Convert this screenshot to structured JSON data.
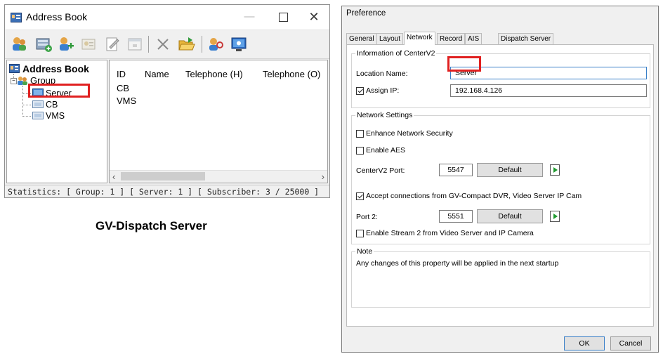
{
  "address_book": {
    "window_title": "Address Book",
    "tree": {
      "root": "Address Book",
      "group": "Group",
      "items": [
        "Server",
        "CB",
        "VMS"
      ]
    },
    "columns": [
      "ID",
      "Name",
      "Telephone (H)",
      "Telephone (O)"
    ],
    "rows": [
      "CB",
      "VMS"
    ],
    "status": "Statistics: [ Group: 1 ]  [ Server: 1 ]  [ Subscriber: 3 / 25000 ]",
    "toolbar_icons": [
      "add-group-icon",
      "add-server-icon",
      "add-subscriber-icon",
      "subscriber-card-icon",
      "edit-icon",
      "properties-icon",
      "delete-icon",
      "open-folder-icon",
      "search-icon",
      "monitor-icon"
    ]
  },
  "caption": "GV-Dispatch Server",
  "preference": {
    "title": "Preference",
    "tabs": [
      "General",
      "Layout",
      "Network",
      "Record",
      "AIS",
      "Dispatch Server"
    ],
    "active_tab": "Network",
    "info_group": {
      "label": "Information of CenterV2",
      "location_label": "Location Name:",
      "location_value": "Server",
      "assign_ip_label": "Assign IP:",
      "assign_ip_checked": true,
      "ip_value": "192.168.4.126"
    },
    "network_group": {
      "label": "Network Settings",
      "enhance_security": "Enhance Network Security",
      "enable_aes": "Enable AES",
      "port_label": "CenterV2 Port:",
      "port_value": "5547",
      "default_label": "Default",
      "accept_connections": "Accept connections from GV-Compact DVR, Video Server  IP Cam",
      "port2_label": "Port 2:",
      "port2_value": "5551",
      "default2_label": "Default",
      "enable_stream2": "Enable Stream 2 from Video Server and IP Camera"
    },
    "note_group": {
      "label": "Note",
      "text": "Any changes of this property will be applied in the next startup"
    },
    "ok_label": "OK",
    "cancel_label": "Cancel"
  },
  "colors": {
    "highlight": "#e02020",
    "accent": "#3a80c8"
  }
}
